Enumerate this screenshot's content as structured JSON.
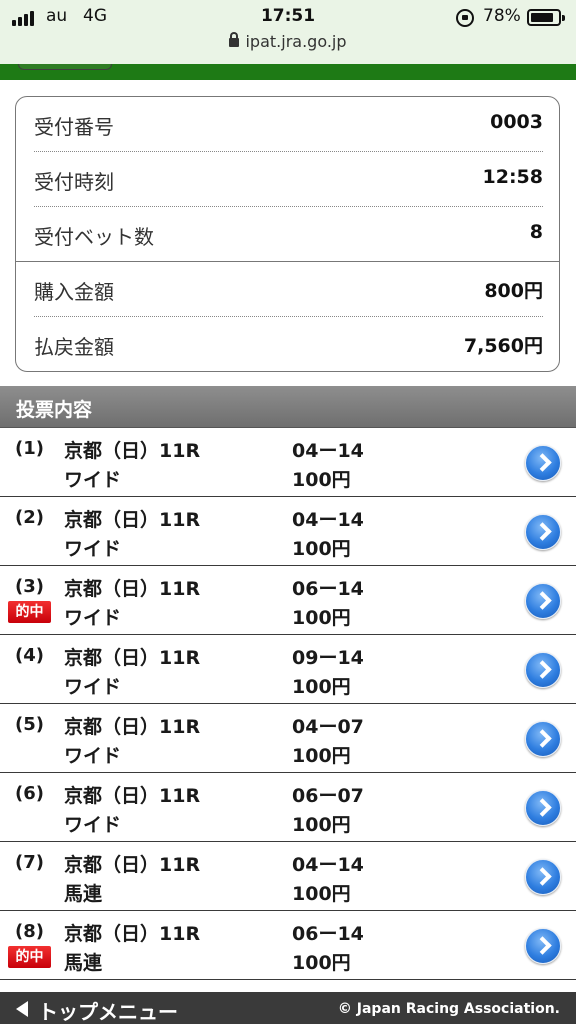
{
  "status_bar": {
    "carrier": "au",
    "network": "4G",
    "time": "17:51",
    "battery_percent": "78%",
    "url": "ipat.jra.go.jp"
  },
  "summary": {
    "rows": [
      {
        "label": "受付番号",
        "value": "0003"
      },
      {
        "label": "受付時刻",
        "value": "12:58"
      },
      {
        "label": "受付ベット数",
        "value": "8"
      },
      {
        "label": "購入金額",
        "value": "800円"
      },
      {
        "label": "払戻金額",
        "value": "7,560円"
      }
    ]
  },
  "section": {
    "title": "投票内容"
  },
  "hit_label": "的中",
  "bets": [
    {
      "num": "(1)",
      "venue": "京都（日）11R",
      "type": "ワイド",
      "combo": "04ー14",
      "amount": "100円",
      "hit": false
    },
    {
      "num": "(2)",
      "venue": "京都（日）11R",
      "type": "ワイド",
      "combo": "04ー14",
      "amount": "100円",
      "hit": false
    },
    {
      "num": "(3)",
      "venue": "京都（日）11R",
      "type": "ワイド",
      "combo": "06ー14",
      "amount": "100円",
      "hit": true
    },
    {
      "num": "(4)",
      "venue": "京都（日）11R",
      "type": "ワイド",
      "combo": "09ー14",
      "amount": "100円",
      "hit": false
    },
    {
      "num": "(5)",
      "venue": "京都（日）11R",
      "type": "ワイド",
      "combo": "04ー07",
      "amount": "100円",
      "hit": false
    },
    {
      "num": "(6)",
      "venue": "京都（日）11R",
      "type": "ワイド",
      "combo": "06ー07",
      "amount": "100円",
      "hit": false
    },
    {
      "num": "(7)",
      "venue": "京都（日）11R",
      "type": "馬連",
      "combo": "04ー14",
      "amount": "100円",
      "hit": false
    },
    {
      "num": "(8)",
      "venue": "京都（日）11R",
      "type": "馬連",
      "combo": "06ー14",
      "amount": "100円",
      "hit": true
    }
  ],
  "footer": {
    "top_menu_label": "トップメニュー",
    "copyright": "© Japan Racing Association."
  },
  "icons": {
    "row_action": "chevron-right-circle-icon",
    "back": "triangle-left-icon"
  },
  "colors": {
    "brand_green": "#1e7a15",
    "hit_red": "#d9000f",
    "action_blue": "#2f7ee0",
    "header_gray": "#7f7f7f",
    "footer_dark": "#3a3a3a"
  }
}
